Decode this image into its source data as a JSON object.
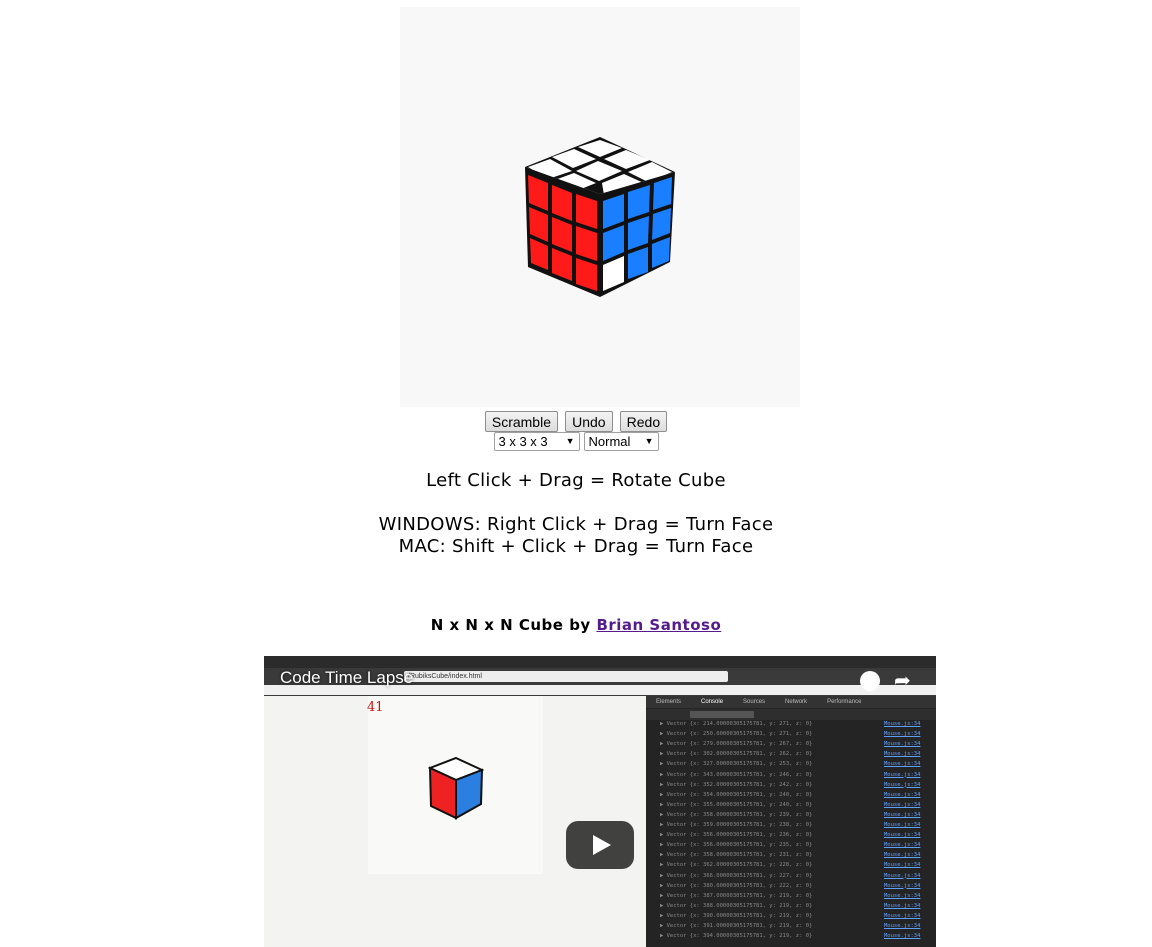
{
  "buttons": {
    "scramble": "Scramble",
    "undo": "Undo",
    "redo": "Redo"
  },
  "selects": {
    "size": "3 x 3 x 3",
    "speed": "Normal"
  },
  "instructions": {
    "rotate": "Left Click + Drag = Rotate Cube",
    "windows": "WINDOWS: Right Click + Drag = Turn Face",
    "mac": "MAC: Shift + Click + Drag = Turn Face"
  },
  "credit": {
    "text": "N x N x N Cube by ",
    "author": "Brian Santoso"
  },
  "video": {
    "title": "Code Time Lapse",
    "address": "/RubiksCube/index.html",
    "move_counter": "41",
    "devtools_tabs": [
      "Elements",
      "Console",
      "Sources",
      "Network",
      "Performance"
    ],
    "log_rows": [
      "▶ Vector {x: 214.00000305175781, y: 271, z: 0}",
      "▶ Vector {x: 250.00000305175781, y: 271, z: 0}",
      "▶ Vector {x: 279.00000305175781, y: 267, z: 0}",
      "▶ Vector {x: 302.00000305175781, y: 262, z: 0}",
      "▶ Vector {x: 327.00000305175781, y: 253, z: 0}",
      "▶ Vector {x: 343.00000305175781, y: 246, z: 0}",
      "▶ Vector {x: 352.00000305175781, y: 242, z: 0}",
      "▶ Vector {x: 354.00000305175781, y: 240, z: 0}",
      "▶ Vector {x: 355.00000305175781, y: 240, z: 0}",
      "▶ Vector {x: 358.00000305175781, y: 239, z: 0}",
      "▶ Vector {x: 359.00000305175781, y: 238, z: 0}",
      "▶ Vector {x: 356.00000305175781, y: 236, z: 0}",
      "▶ Vector {x: 356.00000305175781, y: 235, z: 0}",
      "▶ Vector {x: 358.00000305175781, y: 231, z: 0}",
      "▶ Vector {x: 362.00000305175781, y: 228, z: 0}",
      "▶ Vector {x: 366.00000305175781, y: 227, z: 0}",
      "▶ Vector {x: 380.00000305175781, y: 222, z: 0}",
      "▶ Vector {x: 387.00000305175781, y: 219, z: 0}",
      "▶ Vector {x: 388.00000305175781, y: 219, z: 0}",
      "▶ Vector {x: 390.00000305175781, y: 219, z: 0}",
      "▶ Vector {x: 391.00000305175781, y: 219, z: 0}",
      "▶ Vector {x: 394.00000305175781, y: 219, z: 0}"
    ],
    "log_link": "Mouse.js:34"
  },
  "colors": {
    "red": "#ff1a1a",
    "blue": "#1a7fff",
    "white": "#ffffff",
    "link": "#551a8b"
  }
}
